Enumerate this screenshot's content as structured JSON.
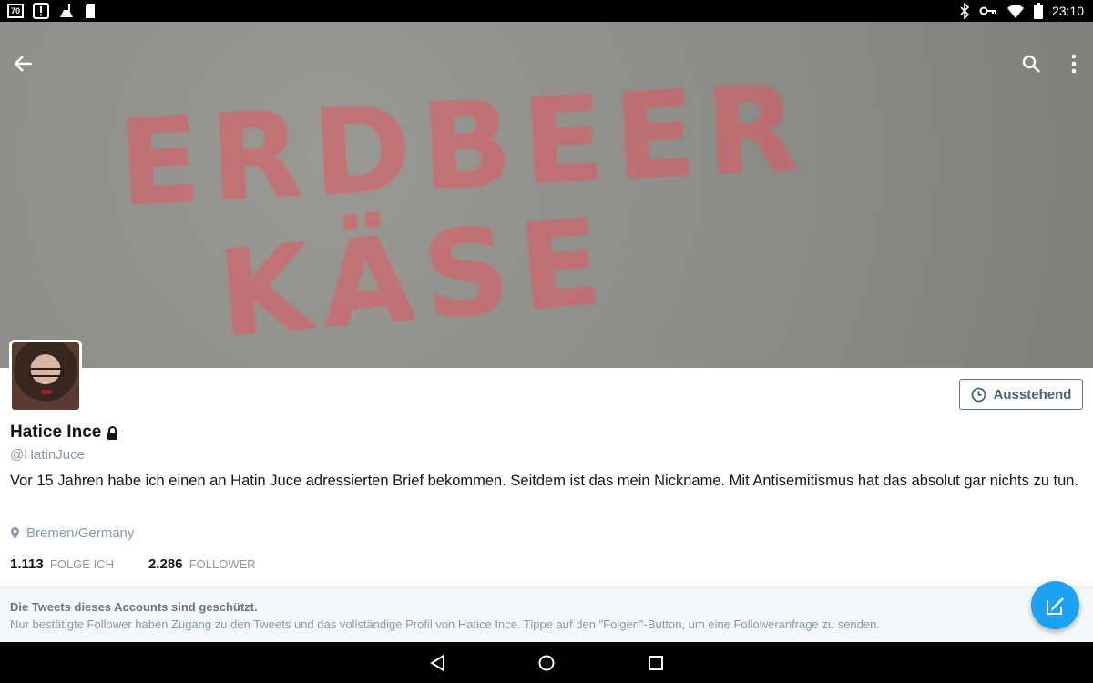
{
  "status_bar": {
    "left_icons": [
      "notification-box-icon",
      "alert-icon",
      "cleaning-icon",
      "sd-card-icon"
    ],
    "left_box_label": "70",
    "right_icons": [
      "bluetooth-icon",
      "vpn-key-icon",
      "wifi-icon",
      "battery-icon"
    ],
    "time": "23:10"
  },
  "header": {
    "banner_text_line1": "ERDBEER",
    "banner_text_line2": "KÄSE",
    "back_icon": "arrow-left-icon",
    "search_icon": "search-icon",
    "more_icon": "more-vertical-icon"
  },
  "profile": {
    "name": "Hatice Ince",
    "handle": "@HatinJuce",
    "bio": "Vor 15 Jahren habe ich einen an Hatin Juce adressierten Brief bekommen. Seitdem ist das mein Nickname. Mit Antisemitismus hat das absolut gar nichts zu tun.",
    "location": "Bremen/Germany",
    "following_count": "1.113",
    "following_label": "FOLGE ICH",
    "followers_count": "2.286",
    "followers_label": "FOLLOWER",
    "pending_button": "Ausstehend"
  },
  "protected_notice": {
    "title": "Die Tweets dieses Accounts sind geschützt.",
    "text": "Nur bestätigte Follower haben Zugang zu den Tweets und das vollständige Profil von Hatice Ince. Tippe auf den \"Folgen\"-Button, um eine Followeranfrage zu senden."
  },
  "colors": {
    "accent": "#1da1f2",
    "muted_text": "#8899a6",
    "button_border": "#5e7787",
    "banner_paint": "#e5555f"
  }
}
